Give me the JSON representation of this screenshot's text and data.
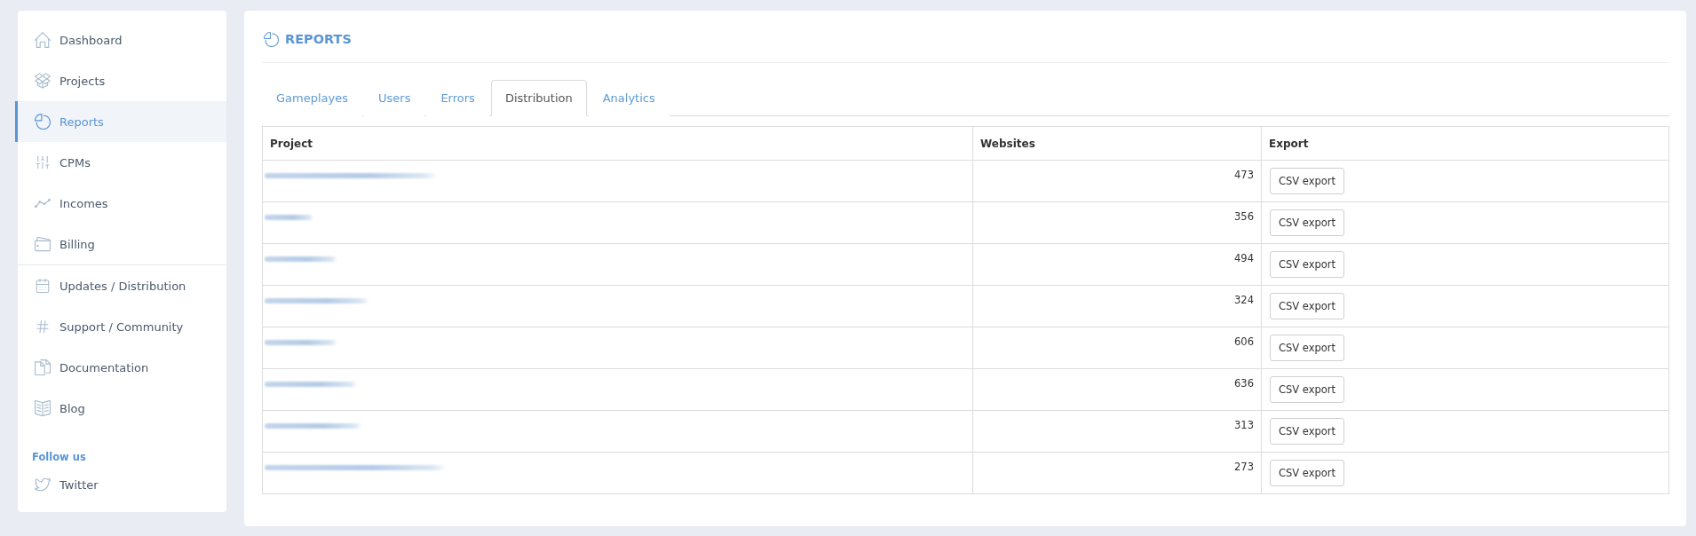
{
  "sidebar": {
    "groups": [
      {
        "items": [
          {
            "label": "Dashboard",
            "selected": false
          },
          {
            "label": "Projects",
            "selected": false
          },
          {
            "label": "Reports",
            "selected": true
          },
          {
            "label": "CPMs",
            "selected": false
          },
          {
            "label": "Incomes",
            "selected": false
          },
          {
            "label": "Billing",
            "selected": false
          }
        ]
      },
      {
        "items": [
          {
            "label": "Updates / Distribution",
            "selected": false
          },
          {
            "label": "Support / Community",
            "selected": false
          },
          {
            "label": "Documentation",
            "selected": false
          },
          {
            "label": "Blog",
            "selected": false
          }
        ]
      }
    ],
    "follow_us": {
      "heading": "Follow us",
      "links": [
        {
          "label": "Twitter"
        }
      ]
    }
  },
  "page": {
    "title": "REPORTS"
  },
  "tabs": [
    {
      "label": "Gameplayes",
      "selected": false
    },
    {
      "label": "Users",
      "selected": false
    },
    {
      "label": "Errors",
      "selected": false
    },
    {
      "label": "Distribution",
      "selected": true
    },
    {
      "label": "Analytics",
      "selected": false
    }
  ],
  "table": {
    "columns": [
      "Project",
      "Websites",
      "Export"
    ],
    "rows": [
      {
        "websites": "473",
        "export_button": "CSV export"
      },
      {
        "websites": "356",
        "export_button": "CSV export"
      },
      {
        "websites": "494",
        "export_button": "CSV export"
      },
      {
        "websites": "324",
        "export_button": "CSV export"
      },
      {
        "websites": "606",
        "export_button": "CSV export"
      },
      {
        "websites": "636",
        "export_button": "CSV export"
      },
      {
        "websites": "313",
        "export_button": "CSV export"
      },
      {
        "websites": "273",
        "export_button": "CSV export"
      }
    ]
  }
}
